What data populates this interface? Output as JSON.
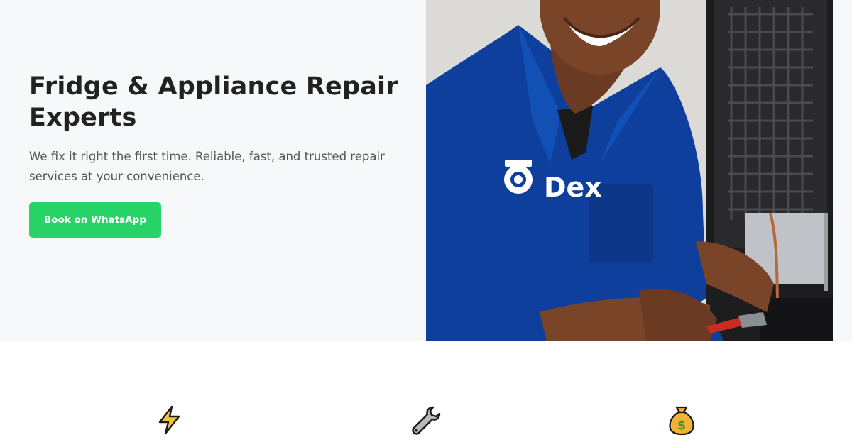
{
  "hero": {
    "title": "Fridge & Appliance Repair Experts",
    "subtitle": "We fix it right the first time. Reliable, fast, and trusted repair services at your convenience.",
    "cta_label": "Book on WhatsApp",
    "photo_logo_text": "Dex"
  },
  "colors": {
    "cta_green": "#27d366",
    "hero_bg": "#f7f8fa",
    "uniform_blue": "#0f3f9c"
  },
  "features": {
    "icons": [
      "lightning-icon",
      "wrench-icon",
      "money-bag-icon"
    ]
  }
}
